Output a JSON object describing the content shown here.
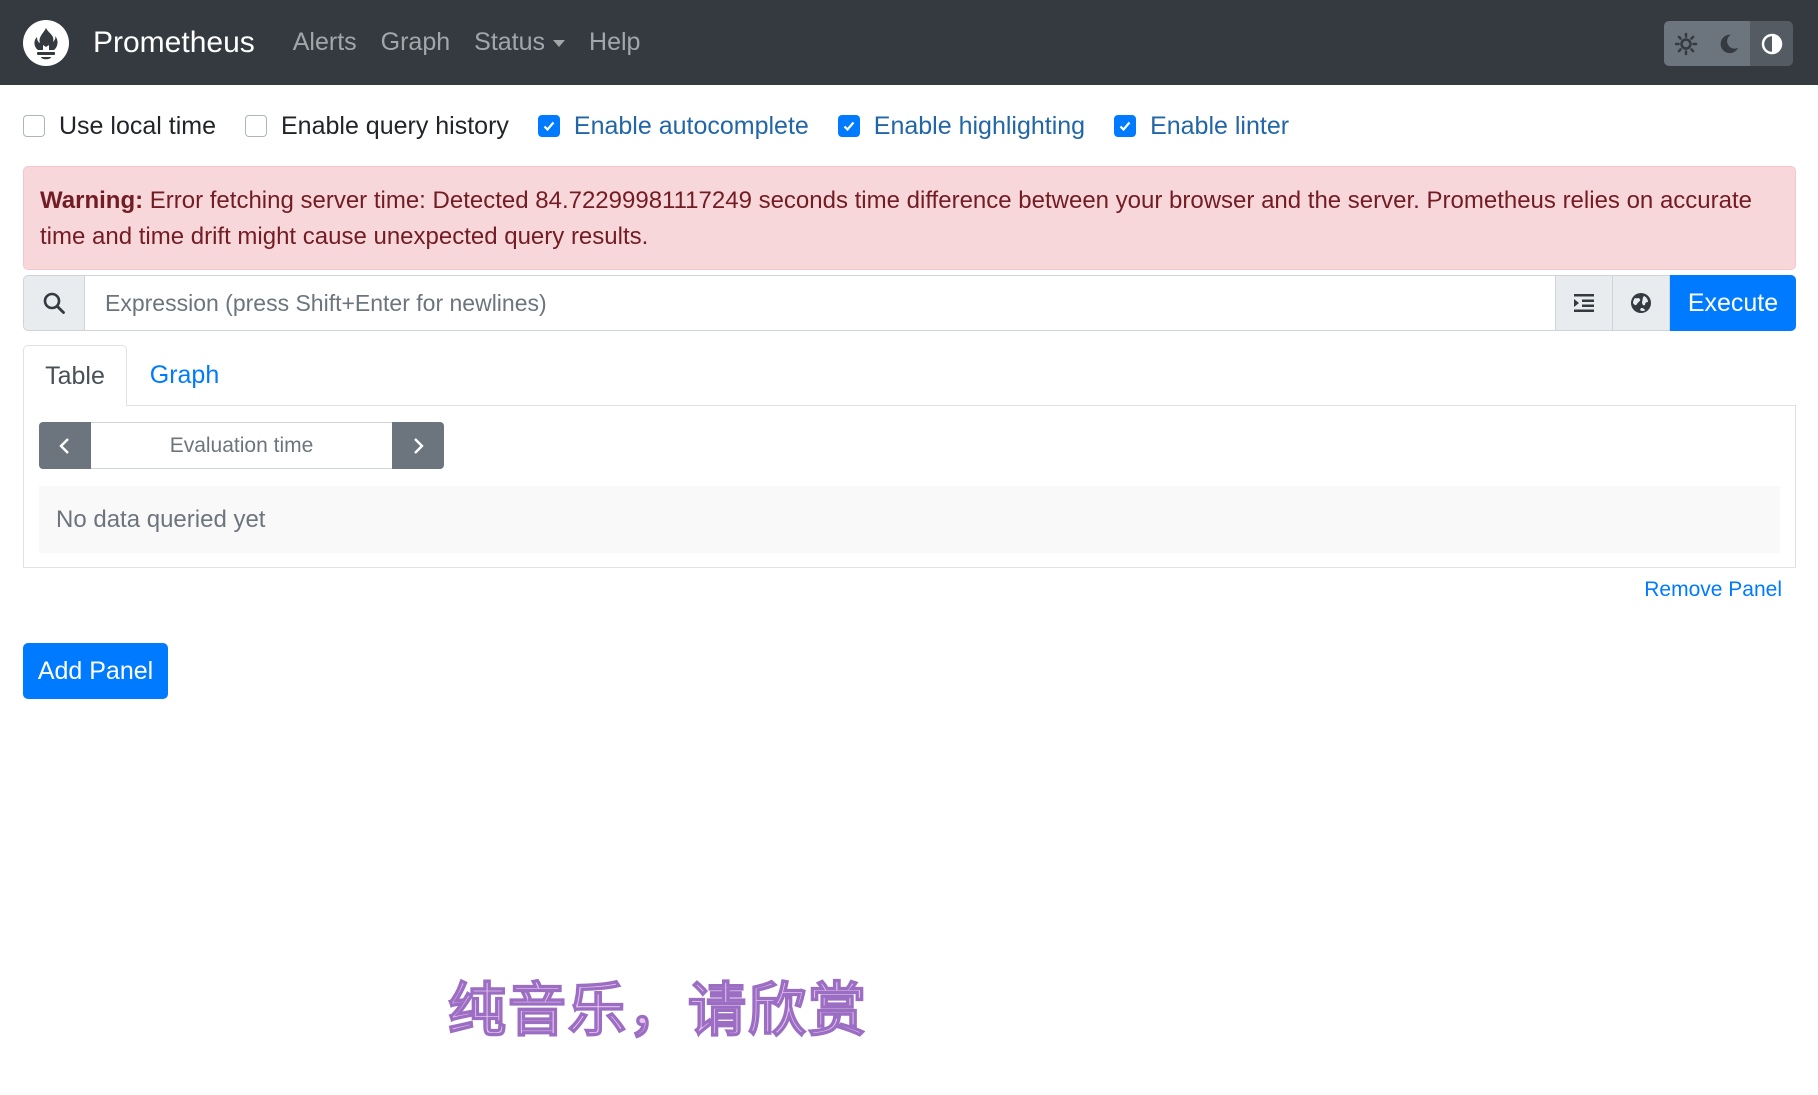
{
  "navbar": {
    "brand": "Prometheus",
    "links": [
      "Alerts",
      "Graph",
      "Status",
      "Help"
    ],
    "theme_buttons": [
      "sun-icon",
      "moon-icon",
      "contrast-icon"
    ]
  },
  "options": [
    {
      "label": "Use local time",
      "checked": false
    },
    {
      "label": "Enable query history",
      "checked": false
    },
    {
      "label": "Enable autocomplete",
      "checked": true
    },
    {
      "label": "Enable highlighting",
      "checked": true
    },
    {
      "label": "Enable linter",
      "checked": true
    }
  ],
  "alert": {
    "strong": "Warning:",
    "message": "Error fetching server time: Detected 84.72299981117249 seconds time difference between your browser and the server. Prometheus relies on accurate time and time drift might cause unexpected query results."
  },
  "expression": {
    "placeholder": "Expression (press Shift+Enter for newlines)",
    "value": "",
    "execute_label": "Execute"
  },
  "panel": {
    "tabs": [
      "Table",
      "Graph"
    ],
    "active_tab": "Table",
    "eval_placeholder": "Evaluation time",
    "no_data": "No data queried yet",
    "remove_label": "Remove Panel"
  },
  "add_panel_label": "Add Panel",
  "watermark": "纯音乐，请欣赏",
  "colors": {
    "navbar": "#343a40",
    "primary": "#007bff",
    "alert_bg": "#f8d7da",
    "alert_text": "#721c24"
  }
}
